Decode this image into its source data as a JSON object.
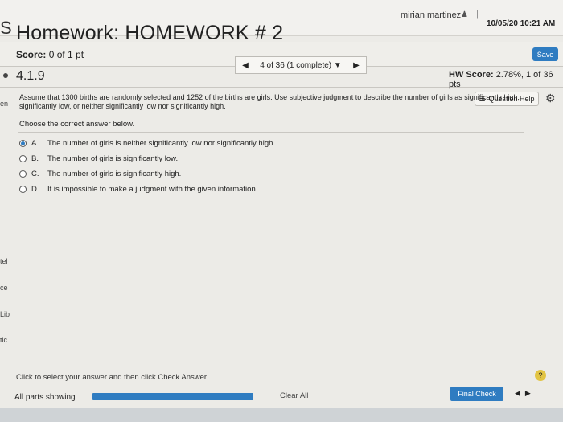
{
  "header": {
    "user_name": "mirian martinez",
    "datetime": "10/05/20 10:21 AM",
    "title": "Homework: HOMEWORK # 2",
    "left_fragment": "S"
  },
  "score": {
    "label": "Score:",
    "value": "0 of 1 pt",
    "save_label": "Save"
  },
  "nav": {
    "current": "4 of 36 (1 complete)"
  },
  "problem": {
    "id": "4.1.9",
    "hw_score_label": "HW Score:",
    "hw_score_value": "2.78%, 1 of 36 pts",
    "question_help_label": "Question Help"
  },
  "question": {
    "text": "Assume that 1300 births are randomly selected and 1252 of the births are girls. Use subjective judgment to describe the number of girls as significantly high, significantly low, or neither significantly low nor significantly high.",
    "prompt": "Choose the correct answer below.",
    "options": [
      {
        "letter": "A.",
        "text": "The number of girls is neither significantly low nor significantly high."
      },
      {
        "letter": "B.",
        "text": "The number of girls is significantly low."
      },
      {
        "letter": "C.",
        "text": "The number of girls is significantly high."
      },
      {
        "letter": "D.",
        "text": "It is impossible to make a judgment with the given information."
      }
    ],
    "selected": "A."
  },
  "left_edge_fragments": [
    "en",
    "tel",
    "ce",
    "Lib",
    "tic"
  ],
  "footer": {
    "instruction": "Click to select your answer and then click Check Answer.",
    "all_parts_label": "All parts showing",
    "clear_label": "Clear All",
    "final_label": "Final Check"
  },
  "colors": {
    "accent": "#2f7cc1",
    "help": "#e2c443"
  }
}
